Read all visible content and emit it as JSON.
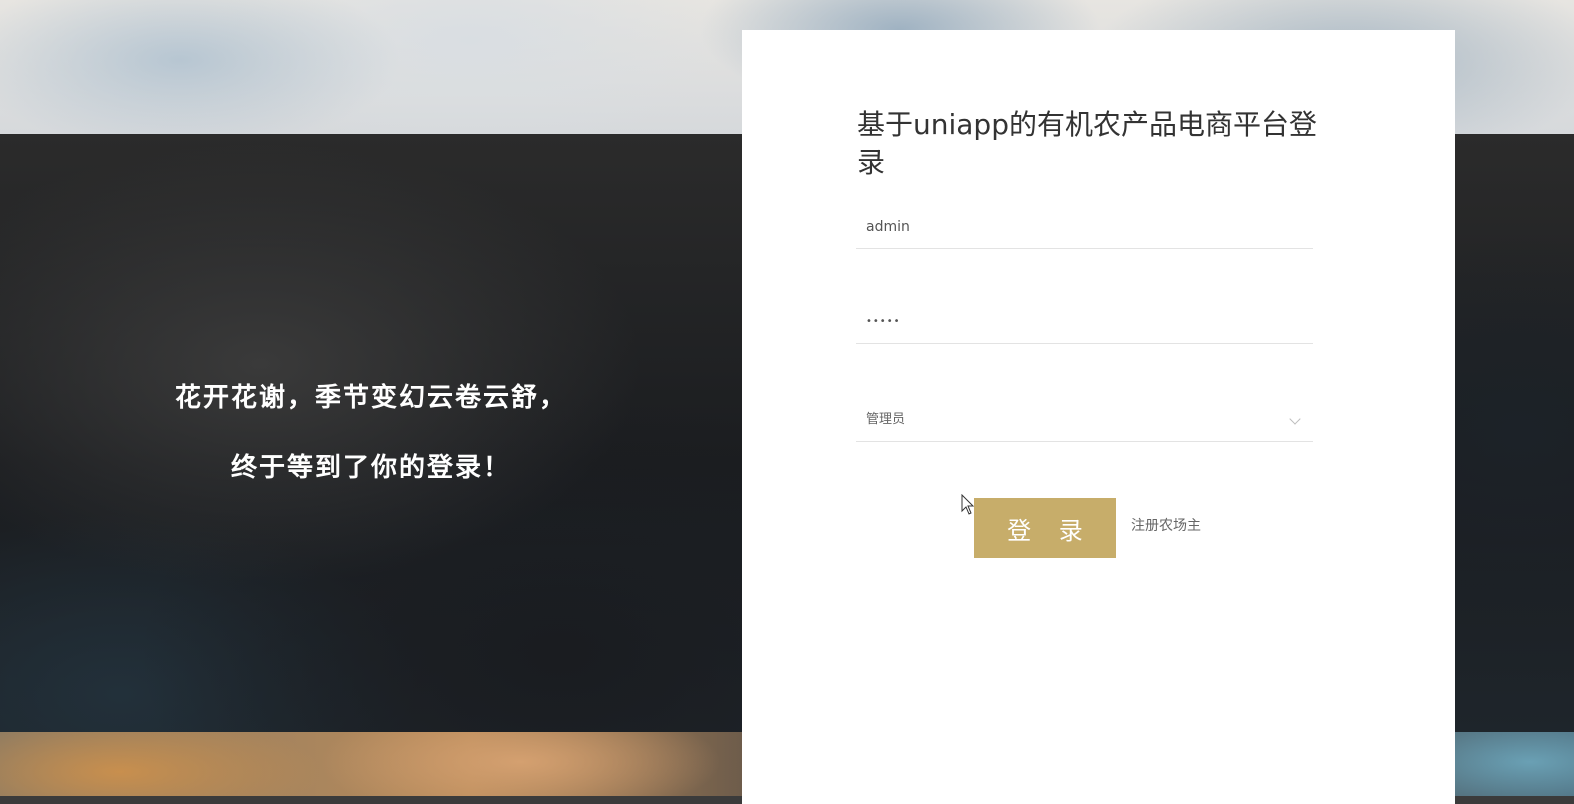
{
  "slogan": {
    "line1": "花开花谢，季节变幻云卷云舒，",
    "line2": "终于等到了你的登录！"
  },
  "login_form": {
    "title": "基于uniapp的有机农产品电商平台登录",
    "username": {
      "value": "admin"
    },
    "password": {
      "value": "•••••"
    },
    "role": {
      "selected": "管理员"
    },
    "login_label": "登 录",
    "register_label": "注册农场主"
  },
  "colors": {
    "accent_button": "#c7ad6a",
    "panel_background": "#ffffff",
    "slogan_text": "#ffffff"
  },
  "icons": {
    "select_arrow": "chevron-down-icon",
    "pointer": "cursor-icon"
  }
}
